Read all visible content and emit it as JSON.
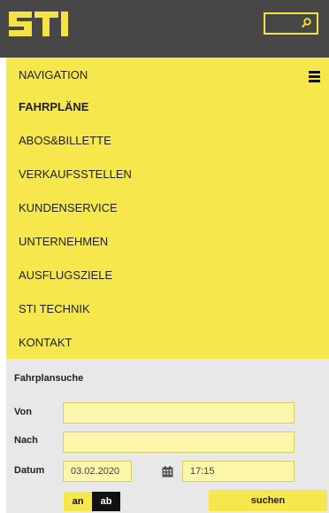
{
  "header": {
    "logo_text": "STI",
    "logo_color": "#f5e244",
    "search_icon": "search-icon"
  },
  "nav": {
    "heading": "NAVIGATION",
    "menu_icon": "hamburger-icon",
    "items": [
      {
        "label": "FAHRPLÄNE",
        "active": true
      },
      {
        "label": "ABOS&BILLETTE"
      },
      {
        "label": "VERKAUFSSTELLEN"
      },
      {
        "label": "KUNDENSERVICE"
      },
      {
        "label": "UNTERNEHMEN"
      },
      {
        "label": "AUSFLUGSZIELE"
      },
      {
        "label": "STI TECHNIK"
      },
      {
        "label": "KONTAKT"
      }
    ]
  },
  "form": {
    "title": "Fahrplansuche",
    "von_label": "Von",
    "von_value": "",
    "nach_label": "Nach",
    "nach_value": "",
    "datum_label": "Datum",
    "datum_value": "03.02.2020",
    "calendar_icon": "calendar-icon",
    "time_value": "17:15",
    "an_label": "an",
    "ab_label": "ab",
    "submit_label": "suchen"
  },
  "colors": {
    "header_bg": "#474747",
    "accent_yellow": "#f6e84c",
    "field_bg": "#fbf6a9",
    "form_bg": "#e8e8e8"
  }
}
